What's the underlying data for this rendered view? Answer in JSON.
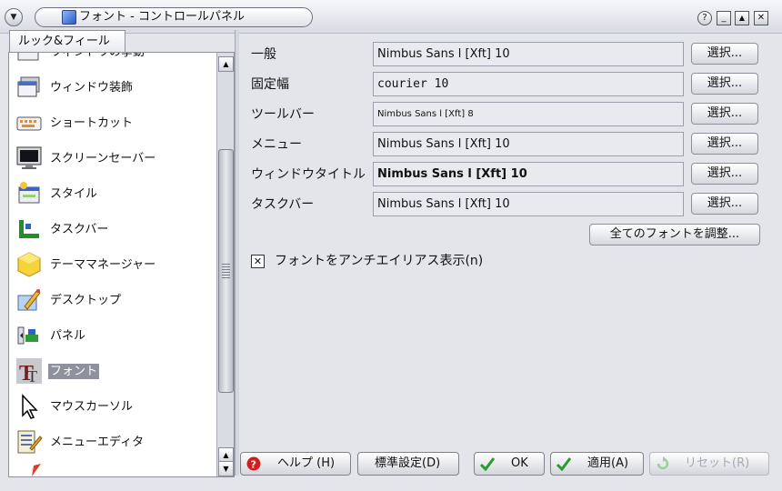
{
  "window": {
    "title": "フォント - コントロールパネル",
    "menu_glyph": "▼",
    "help_glyph": "?",
    "minimize_glyph": "_",
    "maximize_glyph": "▲",
    "close_glyph": "✕"
  },
  "sidebar": {
    "tab_label": "ルック&フィール",
    "items": [
      {
        "label": "ウィンドウの挙動",
        "icon": "window-behavior-icon"
      },
      {
        "label": "ウィンドウ装飾",
        "icon": "window-decoration-icon"
      },
      {
        "label": "ショートカット",
        "icon": "keyboard-shortcut-icon"
      },
      {
        "label": "スクリーンセーバー",
        "icon": "monitor-screensaver-icon"
      },
      {
        "label": "スタイル",
        "icon": "style-icon"
      },
      {
        "label": "タスクバー",
        "icon": "taskbar-icon"
      },
      {
        "label": "テーママネージャー",
        "icon": "theme-manager-icon"
      },
      {
        "label": "デスクトップ",
        "icon": "desktop-icon"
      },
      {
        "label": "パネル",
        "icon": "panel-icon"
      },
      {
        "label": "フォント",
        "icon": "font-icon",
        "selected": true
      },
      {
        "label": "マウスカーソル",
        "icon": "mouse-cursor-icon"
      },
      {
        "label": "メニューエディタ",
        "icon": "menu-editor-icon"
      }
    ],
    "scroll_up_glyph": "▲",
    "scroll_down_glyph": "▼"
  },
  "fonts": {
    "rows": [
      {
        "label": "一般",
        "value": "Nimbus Sans l [Xft] 10",
        "button": "選択..."
      },
      {
        "label": "固定幅",
        "value": "courier 10",
        "button": "選択..."
      },
      {
        "label": "ツールバー",
        "value": "Nimbus Sans l [Xft] 8",
        "button": "選択..."
      },
      {
        "label": "メニュー",
        "value": "Nimbus Sans l [Xft] 10",
        "button": "選択..."
      },
      {
        "label": "ウィンドウタイトル",
        "value": "Nimbus Sans l [Xft] 10",
        "button": "選択..."
      },
      {
        "label": "タスクバー",
        "value": "Nimbus Sans l [Xft] 10",
        "button": "選択..."
      }
    ],
    "adjust_all_label": "全てのフォントを調整...",
    "antialias_label": "フォントをアンチエイリアス表示(n)",
    "antialias_check": "✕"
  },
  "buttons": {
    "help": "ヘルプ (H)",
    "defaults": "標準設定(D)",
    "ok": "OK",
    "apply": "適用(A)",
    "reset": "リセット(R)"
  },
  "colors": {
    "selection_bg": "#8f929c",
    "panel_bg": "#e4e5ea"
  }
}
